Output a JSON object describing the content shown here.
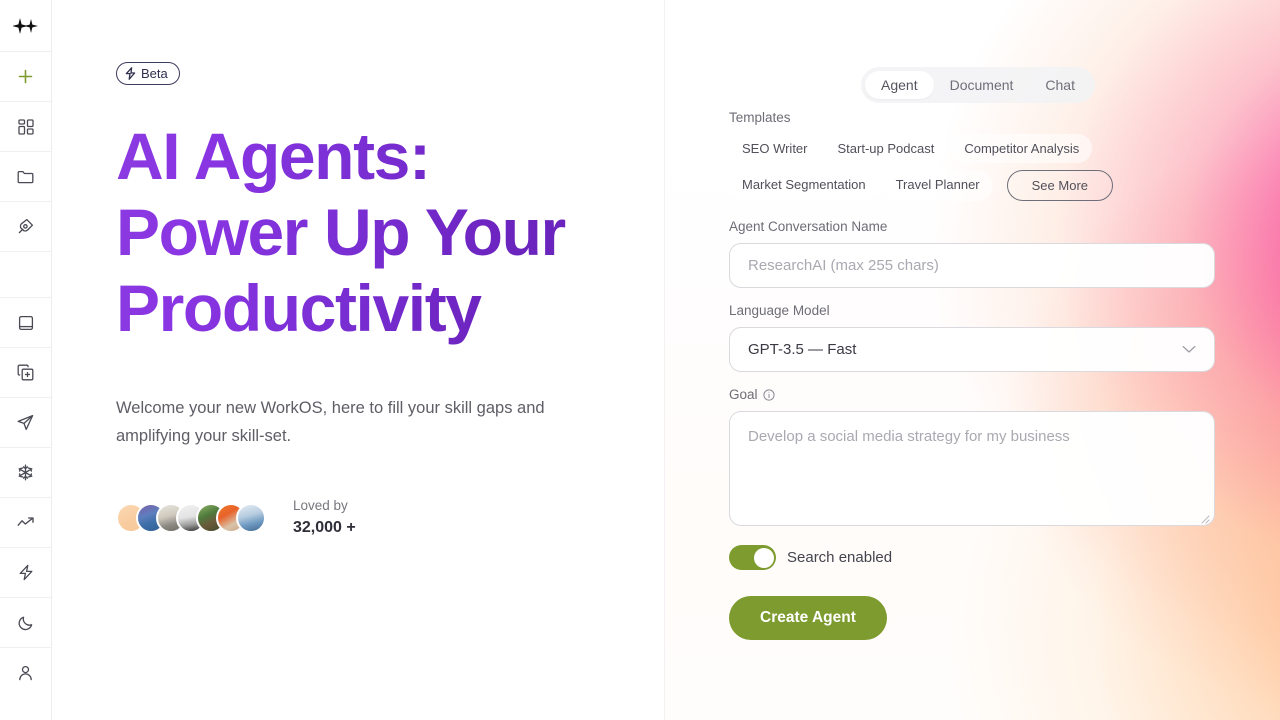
{
  "sidebar": {
    "logo_icon": "sparkles-icon",
    "items": [
      {
        "icon": "plus-icon",
        "name": "new"
      },
      {
        "icon": "grid-dashboard-icon",
        "name": "dashboard"
      },
      {
        "icon": "folder-icon",
        "name": "files"
      },
      {
        "icon": "pen-nib-icon",
        "name": "design"
      },
      {
        "icon": "book-icon",
        "name": "library"
      },
      {
        "icon": "copy-plus-icon",
        "name": "duplicate"
      },
      {
        "icon": "send-icon",
        "name": "send"
      },
      {
        "icon": "snowflake-icon",
        "name": "effects"
      },
      {
        "icon": "trending-up-icon",
        "name": "analytics"
      },
      {
        "icon": "zap-icon",
        "name": "automations"
      },
      {
        "icon": "moon-icon",
        "name": "dark-mode"
      },
      {
        "icon": "user-icon",
        "name": "account"
      }
    ]
  },
  "hero": {
    "badge": {
      "label": "Beta",
      "icon": "bolt-icon"
    },
    "title": "AI Agents:\nPower Up Your\nProductivity",
    "subtitle": "Welcome your new WorkOS, here to fill your skill gaps and amplifying your skill-set.",
    "social_proof": {
      "loved_label": "Loved by",
      "count": "32,000 +",
      "avatar_count": 7
    },
    "title_gradient_from": "#8b3ae0",
    "title_gradient_to": "#6a24bb"
  },
  "panel": {
    "tabs": [
      {
        "label": "Agent",
        "active": true
      },
      {
        "label": "Document",
        "active": false
      },
      {
        "label": "Chat",
        "active": false
      }
    ],
    "templates": {
      "label": "Templates",
      "chips": [
        "SEO Writer",
        "Start-up Podcast",
        "Competitor Analysis",
        "Market Segmentation",
        "Travel Planner"
      ],
      "see_more": "See More"
    },
    "conversation_name": {
      "label": "Agent Conversation Name",
      "placeholder": "ResearchAI (max 255 chars)",
      "value": ""
    },
    "language_model": {
      "label": "Language Model",
      "selected": "GPT-3.5 — Fast",
      "chevron_icon": "chevron-down-icon"
    },
    "goal": {
      "label": "Goal",
      "info_icon": "info-icon",
      "placeholder": "Develop a social media strategy for my business",
      "value": ""
    },
    "search_toggle": {
      "label": "Search enabled",
      "enabled": true
    },
    "create_button": "Create Agent",
    "accent_green": "#7d9b2f",
    "gradient_pink": "#f72196",
    "gradient_peach": "#ffb076"
  }
}
